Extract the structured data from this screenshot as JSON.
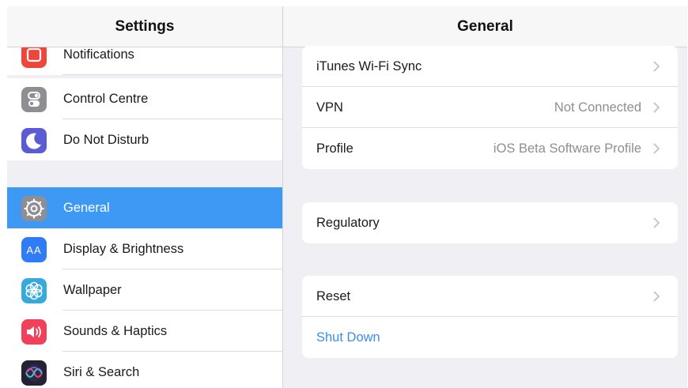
{
  "master": {
    "title": "Settings",
    "items": [
      {
        "label": "Notifications",
        "icon": "notifications-icon",
        "color": "#f0453a"
      },
      {
        "label": "Control Centre",
        "icon": "control-centre-icon",
        "color": "#8e8e93"
      },
      {
        "label": "Do Not Disturb",
        "icon": "moon-icon",
        "color": "#5b5bd6"
      },
      {
        "label": "General",
        "icon": "gear-icon",
        "color": "#8e8e93",
        "selected": true
      },
      {
        "label": "Display & Brightness",
        "icon": "display-brightness-icon",
        "color": "#2f7cf6"
      },
      {
        "label": "Wallpaper",
        "icon": "wallpaper-icon",
        "color": "#36aadc"
      },
      {
        "label": "Sounds & Haptics",
        "icon": "speaker-icon",
        "color": "#f0405a"
      },
      {
        "label": "Siri & Search",
        "icon": "siri-icon",
        "color": "#222233"
      }
    ],
    "aa_glyph": "AA"
  },
  "detail": {
    "title": "General",
    "group1": [
      {
        "label": "iTunes Wi-Fi Sync",
        "value": ""
      },
      {
        "label": "VPN",
        "value": "Not Connected"
      },
      {
        "label": "Profile",
        "value": "iOS Beta Software Profile"
      }
    ],
    "group2": [
      {
        "label": "Regulatory",
        "value": ""
      }
    ],
    "group3": [
      {
        "label": "Reset",
        "value": ""
      },
      {
        "label": "Shut Down",
        "value": ""
      }
    ]
  },
  "colors": {
    "selected": "#3e99f4",
    "link": "#3a8ee6",
    "background": "#efeff4"
  }
}
